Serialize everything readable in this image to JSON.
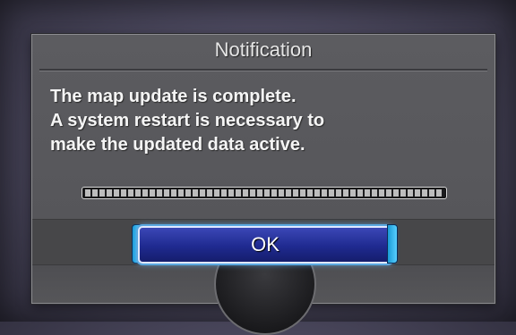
{
  "dialog": {
    "title": "Notification",
    "message_lines": [
      "The map update is complete.",
      "A system restart is necessary to",
      "make the updated data active."
    ],
    "progress": 1.0,
    "ok_label": "OK"
  },
  "colors": {
    "dialog_bg": "#5c5c60",
    "button_bg": "#1f2a90",
    "button_glow": "#69b7ff",
    "text": "#f5f5f5"
  }
}
